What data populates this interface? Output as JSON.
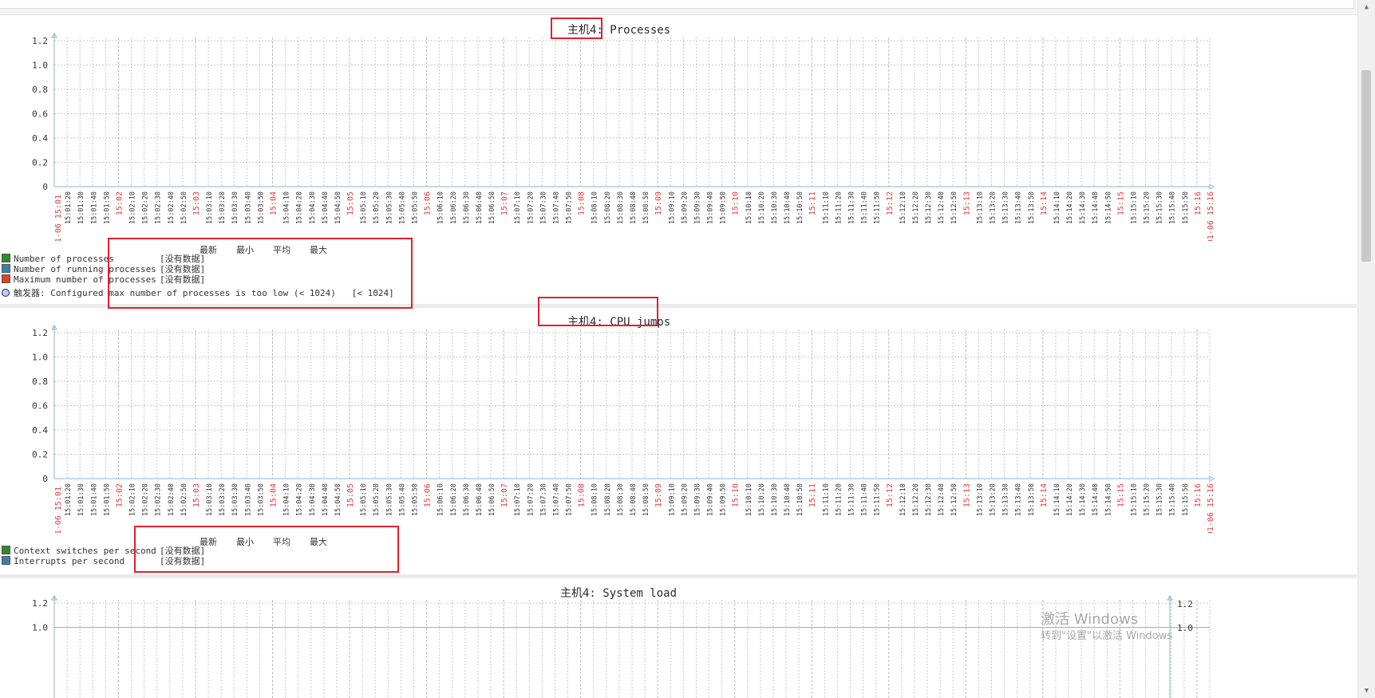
{
  "graphs": [
    {
      "title": "主机4: Processes",
      "y_ticks": [
        "1.2",
        "1.0",
        "0.8",
        "0.6",
        "0.4",
        "0.2",
        "0"
      ],
      "x_start_label": "01-06 15:01",
      "x_end_label": "01-06 15:16",
      "legend_columns": [
        "最新",
        "最小",
        "平均",
        "最大"
      ],
      "items": [
        {
          "name": "Number of processes",
          "value": "[没有数据]",
          "color": "#2e8b2e"
        },
        {
          "name": "Number of running processes",
          "value": "[没有数据]",
          "color": "#3e7fa8"
        },
        {
          "name": "Maximum number of processes",
          "value": "[没有数据]",
          "color": "#e2441f"
        }
      ],
      "trigger": {
        "label": "触发器: Configured max number of processes is too low (< 1024)",
        "value": "[< 1024]"
      }
    },
    {
      "title": "主机4: CPU jumps",
      "y_ticks": [
        "1.2",
        "1.0",
        "0.8",
        "0.6",
        "0.4",
        "0.2",
        "0"
      ],
      "x_start_label": "01-06 15:01",
      "x_end_label": "01-06 15:16",
      "legend_columns": [
        "最新",
        "最小",
        "平均",
        "最大"
      ],
      "items": [
        {
          "name": "Context switches per second",
          "value": "[没有数据]",
          "color": "#2e8b2e"
        },
        {
          "name": "Interrupts per second",
          "value": "[没有数据]",
          "color": "#3e7fa8"
        }
      ]
    },
    {
      "title": "主机4: System load",
      "y_ticks": [
        "1.2",
        "1.0"
      ],
      "right_ticks": [
        "1.2",
        "1.0"
      ]
    }
  ],
  "time_axis": {
    "minor_labels": [
      "15:01:20",
      "15:01:30",
      "15:01:40",
      "15:01:50",
      "15:02",
      "15:02:10",
      "15:02:20",
      "15:02:30",
      "15:02:40",
      "15:02:50",
      "15:03",
      "15:03:10",
      "15:03:20",
      "15:03:30",
      "15:03:40",
      "15:03:50",
      "15:04",
      "15:04:10",
      "15:04:20",
      "15:04:30",
      "15:04:40",
      "15:04:50",
      "15:05",
      "15:05:10",
      "15:05:20",
      "15:05:30",
      "15:05:40",
      "15:05:50",
      "15:06",
      "15:06:10",
      "15:06:20",
      "15:06:30",
      "15:06:40",
      "15:06:50",
      "15:07",
      "15:07:10",
      "15:07:20",
      "15:07:30",
      "15:07:40",
      "15:07:50",
      "15:08",
      "15:08:10",
      "15:08:20",
      "15:08:30",
      "15:08:40",
      "15:08:50",
      "15:09",
      "15:09:10",
      "15:09:20",
      "15:09:30",
      "15:09:40",
      "15:09:50",
      "15:10",
      "15:10:10",
      "15:10:20",
      "15:10:30",
      "15:10:40",
      "15:10:50",
      "15:11",
      "15:11:10",
      "15:11:20",
      "15:11:30",
      "15:11:40",
      "15:11:50",
      "15:12",
      "15:12:10",
      "15:12:20",
      "15:12:30",
      "15:12:40",
      "15:12:50",
      "15:13",
      "15:13:10",
      "15:13:20",
      "15:13:30",
      "15:13:40",
      "15:13:50",
      "15:14",
      "15:14:10",
      "15:14:20",
      "15:14:30",
      "15:14:40",
      "15:14:50",
      "15:15",
      "15:15:10",
      "15:15:20",
      "15:15:30",
      "15:15:40",
      "15:15:50",
      "15:16"
    ]
  },
  "colors": {
    "major_label": "#e83a3a",
    "grid": "#c8c8c8",
    "axis": "#8fb3cf",
    "highlight_box": "#e0212e"
  },
  "watermark": {
    "line1": "激活 Windows",
    "line2": "转到\"设置\"以激活 Windows"
  },
  "scroll_icons": {
    "up": "scroll-up-icon",
    "down": "scroll-down-icon"
  }
}
